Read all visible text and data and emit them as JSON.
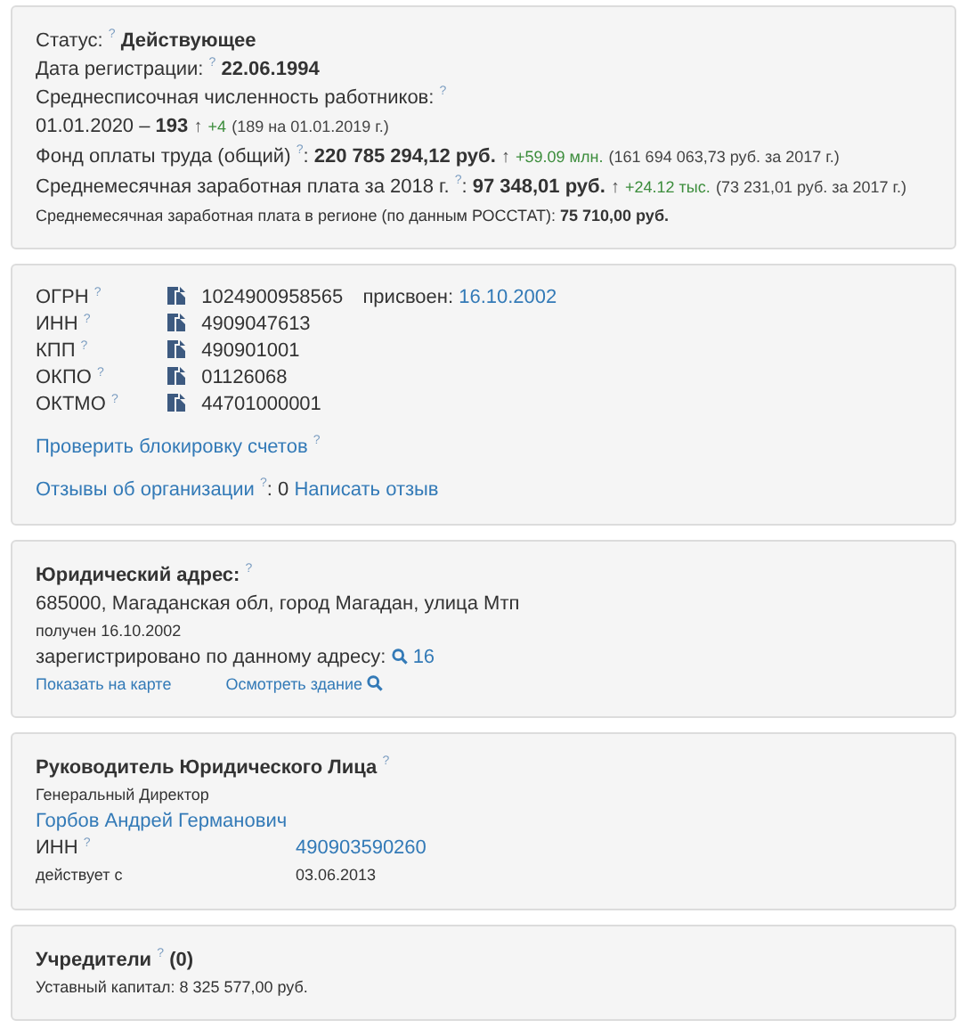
{
  "panels": [
    {
      "lines": [
        {
          "kind": "normal",
          "parts": [
            {
              "kind": "text",
              "text": "Статус:"
            },
            {
              "kind": "hint",
              "text": "?"
            },
            {
              "kind": "bold",
              "text": "Действующее"
            }
          ]
        },
        {
          "kind": "normal",
          "parts": [
            {
              "kind": "text",
              "text": "Дата регистрации:"
            },
            {
              "kind": "hint",
              "text": "?"
            },
            {
              "kind": "bold",
              "text": "22.06.1994"
            }
          ]
        },
        {
          "kind": "normal",
          "parts": [
            {
              "kind": "text",
              "text": "Среднесписочная численность работников:"
            },
            {
              "kind": "hint",
              "text": "?"
            }
          ]
        },
        {
          "kind": "normal",
          "parts": [
            {
              "kind": "text",
              "text": "01.01.2020 –"
            },
            {
              "kind": "bold",
              "text": "193"
            },
            {
              "kind": "arrow",
              "text": "↑"
            },
            {
              "kind": "delta",
              "text": "+4"
            },
            {
              "kind": "note",
              "text": "(189 на 01.01.2019 г.)"
            }
          ]
        },
        {
          "kind": "normal",
          "parts": [
            {
              "kind": "text",
              "text": "Фонд оплаты труда (общий)"
            },
            {
              "kind": "hint",
              "text": "?"
            },
            {
              "kind": "tail",
              "text": ":"
            },
            {
              "kind": "bold",
              "text": "220 785 294,12 руб."
            },
            {
              "kind": "arrow",
              "text": "↑"
            },
            {
              "kind": "delta",
              "text": "+59.09 млн."
            },
            {
              "kind": "note",
              "text": "(161 694 063,73 руб. за 2017 г.)"
            }
          ]
        },
        {
          "kind": "normal",
          "parts": [
            {
              "kind": "text",
              "text": "Среднемесячная заработная плата за 2018 г."
            },
            {
              "kind": "hint",
              "text": "?"
            },
            {
              "kind": "tail",
              "text": ":"
            },
            {
              "kind": "bold",
              "text": "97 348,01 руб."
            },
            {
              "kind": "arrow",
              "text": "↑"
            },
            {
              "kind": "delta",
              "text": "+24.12 тыс."
            },
            {
              "kind": "note",
              "text": "(73 231,01 руб. за 2017 г.)"
            }
          ]
        },
        {
          "kind": "small",
          "parts": [
            {
              "kind": "text",
              "text": "Среднемесячная заработная плата в регионе (по данным РОССТАТ):"
            },
            {
              "kind": "bold",
              "text": "75 710,00 руб."
            }
          ]
        }
      ]
    },
    {
      "lines": [
        {
          "kind": "code",
          "label": [
            {
              "kind": "text",
              "text": "ОГРН"
            },
            {
              "kind": "hint",
              "text": "?"
            }
          ],
          "value": [
            {
              "kind": "copy-icon"
            },
            {
              "kind": "text",
              "text": "1024900958565"
            },
            {
              "kind": "aside",
              "text": "присвоен:"
            },
            {
              "kind": "link",
              "text": "16.10.2002"
            }
          ]
        },
        {
          "kind": "code",
          "label": [
            {
              "kind": "text",
              "text": "ИНН"
            },
            {
              "kind": "hint",
              "text": "?"
            }
          ],
          "value": [
            {
              "kind": "copy-icon"
            },
            {
              "kind": "text",
              "text": "4909047613"
            }
          ]
        },
        {
          "kind": "code",
          "label": [
            {
              "kind": "text",
              "text": "КПП"
            },
            {
              "kind": "hint",
              "text": "?"
            }
          ],
          "value": [
            {
              "kind": "copy-icon"
            },
            {
              "kind": "text",
              "text": "490901001"
            }
          ]
        },
        {
          "kind": "code",
          "label": [
            {
              "kind": "text",
              "text": "ОКПО"
            },
            {
              "kind": "hint",
              "text": "?"
            }
          ],
          "value": [
            {
              "kind": "copy-icon"
            },
            {
              "kind": "text",
              "text": "01126068"
            }
          ]
        },
        {
          "kind": "code",
          "label": [
            {
              "kind": "text",
              "text": "ОКТМО"
            },
            {
              "kind": "hint",
              "text": "?"
            }
          ],
          "value": [
            {
              "kind": "copy-icon"
            },
            {
              "kind": "text",
              "text": "44701000001"
            }
          ]
        },
        {
          "kind": "spaced",
          "parts": [
            {
              "kind": "link",
              "text": "Проверить блокировку счетов"
            },
            {
              "kind": "hint",
              "text": "?"
            }
          ]
        },
        {
          "kind": "spaced",
          "parts": [
            {
              "kind": "link",
              "text": "Отзывы об организации"
            },
            {
              "kind": "hint",
              "text": "?"
            },
            {
              "kind": "tail",
              "text": ":"
            },
            {
              "kind": "text",
              "text": "0"
            },
            {
              "kind": "link",
              "text": "Написать отзыв"
            }
          ]
        }
      ]
    },
    {
      "lines": [
        {
          "kind": "normal",
          "parts": [
            {
              "kind": "bold",
              "text": "Юридический адрес:"
            },
            {
              "kind": "hint",
              "text": "?"
            }
          ]
        },
        {
          "kind": "normal",
          "parts": [
            {
              "kind": "text",
              "text": "685000, Магаданская обл, город Магадан, улица Мтп"
            }
          ]
        },
        {
          "kind": "small",
          "parts": [
            {
              "kind": "text",
              "text": "получен 16.10.2002"
            }
          ]
        },
        {
          "kind": "normal",
          "parts": [
            {
              "kind": "text",
              "text": "зарегистрировано по данному адресу:"
            },
            {
              "kind": "search-link-before",
              "text": "16"
            }
          ]
        },
        {
          "kind": "small",
          "parts": [
            {
              "kind": "link",
              "text": "Показать на карте"
            },
            {
              "kind": "search-link-after",
              "text": "Осмотреть здание"
            }
          ]
        }
      ]
    },
    {
      "lines": [
        {
          "kind": "normal",
          "parts": [
            {
              "kind": "bold",
              "text": "Руководитель Юридического Лица"
            },
            {
              "kind": "hint",
              "text": "?"
            }
          ]
        },
        {
          "kind": "small",
          "parts": [
            {
              "kind": "text",
              "text": "Генеральный Директор"
            }
          ]
        },
        {
          "kind": "normal",
          "parts": [
            {
              "kind": "link",
              "text": "Горбов Андрей Германович"
            }
          ]
        },
        {
          "kind": "pair",
          "label": [
            {
              "kind": "text",
              "text": "ИНН"
            },
            {
              "kind": "hint",
              "text": "?"
            }
          ],
          "value": [
            {
              "kind": "link",
              "text": "490903590260"
            }
          ]
        },
        {
          "kind": "small-pair",
          "label": [
            {
              "kind": "text",
              "text": "действует с"
            }
          ],
          "value": [
            {
              "kind": "text",
              "text": "03.06.2013"
            }
          ]
        }
      ]
    },
    {
      "lines": [
        {
          "kind": "normal",
          "parts": [
            {
              "kind": "bold",
              "text": "Учредители"
            },
            {
              "kind": "hint",
              "text": "?"
            },
            {
              "kind": "bold",
              "text": "(0)"
            }
          ]
        },
        {
          "kind": "small",
          "parts": [
            {
              "kind": "text",
              "text": "Уставный капитал: 8 325 577,00 руб."
            }
          ]
        }
      ]
    }
  ]
}
